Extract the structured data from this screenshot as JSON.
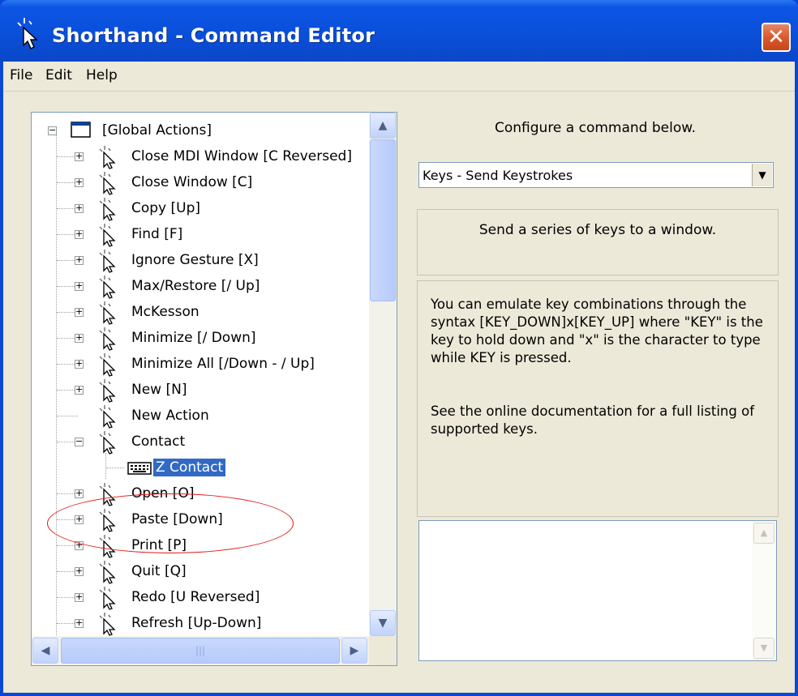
{
  "window": {
    "title": "Shorthand - Command Editor",
    "close_label": "✕"
  },
  "menu": [
    "File",
    "Edit",
    "Help"
  ],
  "tree": {
    "root_label": "[Global Actions]",
    "items": [
      {
        "label": "Close MDI Window [C Reversed]"
      },
      {
        "label": "Close Window [C]"
      },
      {
        "label": "Copy [Up]"
      },
      {
        "label": "Find [F]"
      },
      {
        "label": "Ignore Gesture [X]"
      },
      {
        "label": "Max/Restore [/ Up]"
      },
      {
        "label": "McKesson"
      },
      {
        "label": "Minimize [/ Down]"
      },
      {
        "label": "Minimize All [/Down - / Up]"
      },
      {
        "label": "New [N]"
      },
      {
        "label": "New Action"
      },
      {
        "label": "Contact"
      },
      {
        "label": "Z Contact",
        "selected": true
      },
      {
        "label": "Open [O]"
      },
      {
        "label": "Paste [Down]"
      },
      {
        "label": "Print [P]"
      },
      {
        "label": "Quit [Q]"
      },
      {
        "label": "Redo [U Reversed]"
      },
      {
        "label": "Refresh [Up-Down]"
      }
    ]
  },
  "panel": {
    "heading": "Configure a command below.",
    "command_type": "Keys - Send Keystrokes",
    "description": "Send a series of keys to a window.",
    "help_paragraph_1": "You can emulate key combinations through the syntax [KEY_DOWN]x[KEY_UP] where \"KEY\" is the key to hold down and \"x\" is the character to type while KEY is pressed.",
    "help_paragraph_2": "See the online documentation for a full listing of supported keys.",
    "keystrokes_value": ""
  },
  "colors": {
    "selection": "#316ac5",
    "annotation": "#e01818",
    "titlebar": "#0a4fd9"
  }
}
